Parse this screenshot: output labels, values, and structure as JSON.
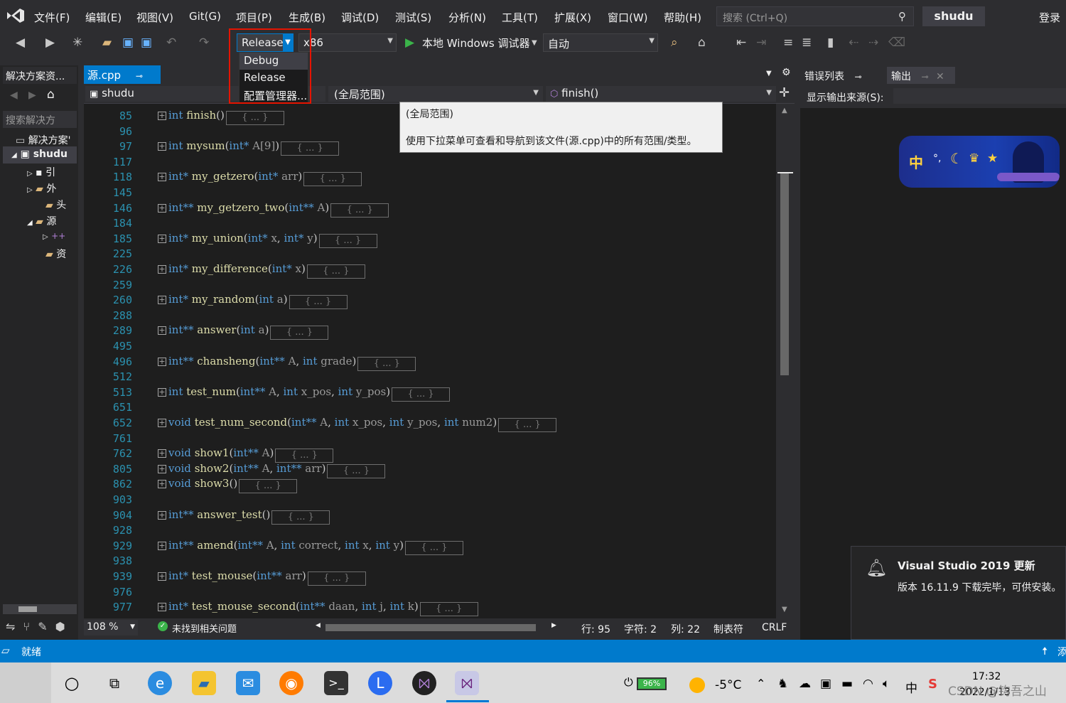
{
  "menu": {
    "items": [
      "文件(F)",
      "编辑(E)",
      "视图(V)",
      "Git(G)",
      "项目(P)",
      "生成(B)",
      "调试(D)",
      "测试(S)",
      "分析(N)",
      "工具(T)",
      "扩展(X)",
      "窗口(W)",
      "帮助(H)"
    ],
    "search_placeholder": "搜索 (Ctrl+Q)",
    "project_name": "shudu",
    "login": "登录"
  },
  "toolbar": {
    "config_value": "Release",
    "platform_value": "x86",
    "debugger_label": "本地 Windows 调试器",
    "auto_value": "自动",
    "config_options": [
      "Debug",
      "Release",
      "配置管理器..."
    ]
  },
  "solution_explorer": {
    "tab_label": "解决方案资...",
    "search_placeholder": "搜索解决方",
    "tree": [
      "解决方案'",
      "shudu",
      "引",
      "外",
      "头",
      "源",
      "",
      "资"
    ]
  },
  "editor": {
    "tab_label": "源.cpp",
    "project_combo": "shudu",
    "scope_combo": "(全局范围)",
    "member_combo": "finish()",
    "tooltip_title": "(全局范围)",
    "tooltip_text": "使用下拉菜单可查看和导航到该文件(源.cpp)中的所有范围/类型。",
    "lines": [
      {
        "ln": "85",
        "ret": "int",
        "ptr": "",
        "name": "finish",
        "params": [],
        "collapsed": "{ ... }"
      },
      {
        "ln": "96"
      },
      {
        "ln": "97",
        "ret": "int",
        "ptr": "",
        "name": "mysum",
        "params": [
          {
            "t": "int*",
            "n": "A[9]"
          }
        ],
        "collapsed": "{ ... }"
      },
      {
        "ln": "117"
      },
      {
        "ln": "118",
        "ret": "int*",
        "ptr": "",
        "name": "my_getzero",
        "params": [
          {
            "t": "int*",
            "n": "arr"
          }
        ],
        "collapsed": "{ ... }"
      },
      {
        "ln": "145"
      },
      {
        "ln": "146",
        "ret": "int**",
        "ptr": "",
        "name": "my_getzero_two",
        "params": [
          {
            "t": "int**",
            "n": "A"
          }
        ],
        "collapsed": "{ ... }"
      },
      {
        "ln": "184"
      },
      {
        "ln": "185",
        "ret": "int*",
        "ptr": "",
        "name": "my_union",
        "params": [
          {
            "t": "int*",
            "n": "x"
          },
          {
            "t": "int*",
            "n": "y"
          }
        ],
        "collapsed": "{ ... }"
      },
      {
        "ln": "225"
      },
      {
        "ln": "226",
        "ret": "int*",
        "ptr": "",
        "name": "my_difference",
        "params": [
          {
            "t": "int*",
            "n": "x"
          }
        ],
        "collapsed": "{ ... }"
      },
      {
        "ln": "259"
      },
      {
        "ln": "260",
        "ret": "int*",
        "ptr": "",
        "name": "my_random",
        "params": [
          {
            "t": "int",
            "n": "a"
          }
        ],
        "collapsed": "{ ... }"
      },
      {
        "ln": "288"
      },
      {
        "ln": "289",
        "ret": "int**",
        "ptr": "",
        "name": "answer",
        "params": [
          {
            "t": "int",
            "n": "a"
          }
        ],
        "collapsed": "{ ... }"
      },
      {
        "ln": "495"
      },
      {
        "ln": "496",
        "ret": "int**",
        "ptr": "",
        "name": "chansheng",
        "params": [
          {
            "t": "int**",
            "n": "A"
          },
          {
            "t": "int",
            "n": "grade"
          }
        ],
        "collapsed": "{ ... }"
      },
      {
        "ln": "512"
      },
      {
        "ln": "513",
        "ret": "int",
        "ptr": "",
        "name": "test_num",
        "params": [
          {
            "t": "int**",
            "n": "A"
          },
          {
            "t": "int",
            "n": "x_pos"
          },
          {
            "t": "int",
            "n": "y_pos"
          }
        ],
        "collapsed": "{ ... }"
      },
      {
        "ln": "651"
      },
      {
        "ln": "652",
        "ret": "void",
        "ptr": "",
        "name": "test_num_second",
        "params": [
          {
            "t": "int**",
            "n": "A"
          },
          {
            "t": "int",
            "n": "x_pos"
          },
          {
            "t": "int",
            "n": "y_pos"
          },
          {
            "t": "int",
            "n": "num2"
          }
        ],
        "collapsed": "{ ... }"
      },
      {
        "ln": "761"
      },
      {
        "ln": "762",
        "ret": "void",
        "ptr": "",
        "name": "show1",
        "params": [
          {
            "t": "int**",
            "n": "A"
          }
        ],
        "collapsed": "{ ... }"
      },
      {
        "ln": "805",
        "ret": "void",
        "ptr": "",
        "name": "show2",
        "params": [
          {
            "t": "int**",
            "n": "A"
          },
          {
            "t": "int**",
            "n": "arr"
          }
        ],
        "collapsed": "{ ... }"
      },
      {
        "ln": "862",
        "ret": "void",
        "ptr": "",
        "name": "show3",
        "params": [],
        "collapsed": "{ ... }"
      },
      {
        "ln": "903"
      },
      {
        "ln": "904",
        "ret": "int**",
        "ptr": "",
        "name": "answer_test",
        "params": [],
        "collapsed": "{ ... }"
      },
      {
        "ln": "928"
      },
      {
        "ln": "929",
        "ret": "int**",
        "ptr": "",
        "name": "amend",
        "params": [
          {
            "t": "int**",
            "n": "A"
          },
          {
            "t": "int",
            "n": "correct"
          },
          {
            "t": "int",
            "n": "x"
          },
          {
            "t": "int",
            "n": "y"
          }
        ],
        "collapsed": "{ ... }"
      },
      {
        "ln": "938"
      },
      {
        "ln": "939",
        "ret": "int*",
        "ptr": "",
        "name": "test_mouse",
        "params": [
          {
            "t": "int**",
            "n": "arr"
          }
        ],
        "collapsed": "{ ... }"
      },
      {
        "ln": "976"
      },
      {
        "ln": "977",
        "ret": "int*",
        "ptr": "",
        "name": "test_mouse_second",
        "params": [
          {
            "t": "int**",
            "n": "daan"
          },
          {
            "t": "int",
            "n": "j"
          },
          {
            "t": "int",
            "n": "k"
          }
        ],
        "collapsed": "{ ... }"
      }
    ],
    "zoom": "108 %",
    "issues": "未找到相关问题",
    "row": "行: 95",
    "char": "字符: 2",
    "col": "列: 22",
    "tabs_mode": "制表符",
    "eol": "CRLF"
  },
  "right_panel": {
    "tab_errors": "错误列表",
    "tab_output": "输出",
    "output_source_label": "显示输出来源(S):",
    "banner_glyph": "中"
  },
  "notification": {
    "title": "Visual Studio 2019 更新",
    "body": "版本 16.11.9 下载完毕，可供安装。"
  },
  "statusbar": {
    "ready": "就绪",
    "right_text": "添"
  },
  "taskbar": {
    "battery": "96%",
    "temperature": "-5°C",
    "ime": "中",
    "time": "17:32",
    "date": "2022/1/13",
    "watermark": "CSDN @钩吾之山"
  },
  "colors": {
    "accent": "#007acc",
    "editor_bg": "#1e1e1e",
    "keyword": "#569cd6",
    "function": "#dcdcaa",
    "line_number": "#2b91af",
    "highlight_frame": "#e51400"
  }
}
